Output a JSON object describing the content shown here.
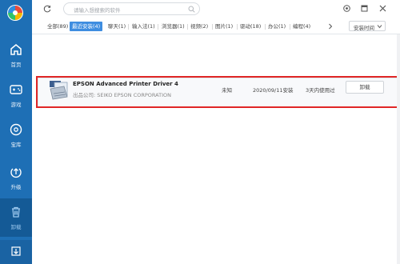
{
  "sidebar": {
    "items": [
      {
        "label": "首页",
        "icon": "home-icon"
      },
      {
        "label": "游戏",
        "icon": "gamepad-icon"
      },
      {
        "label": "宝库",
        "icon": "disc-icon"
      },
      {
        "label": "升级",
        "icon": "upgrade-icon"
      },
      {
        "label": "卸载",
        "icon": "trash-icon"
      }
    ],
    "bottom_icon": "download-icon"
  },
  "topbar": {
    "search_placeholder": "请输入想搜索的软件"
  },
  "tabs": [
    {
      "label": "全部(89)"
    },
    {
      "label": "最近安装(4)"
    },
    {
      "label": "聊天(1)"
    },
    {
      "label": "输入法(1)"
    },
    {
      "label": "浏览器(1)"
    },
    {
      "label": "视频(2)"
    },
    {
      "label": "图片(1)"
    },
    {
      "label": "驱动(18)"
    },
    {
      "label": "办公(1)"
    },
    {
      "label": "编程(4)"
    }
  ],
  "sort": {
    "label": "安装时间"
  },
  "apps": [
    {
      "name": "EPSON Advanced Printer Driver 4",
      "publisher": "出品公司: SEIKO EPSON CORPORATION",
      "size": "未知",
      "date": "2020/09/11安装",
      "usage": "3天内使用过",
      "action": "卸载"
    }
  ],
  "colors": {
    "sidebar": "#1e6fb5",
    "accent": "#3e8de0",
    "highlight": "#e02626"
  }
}
